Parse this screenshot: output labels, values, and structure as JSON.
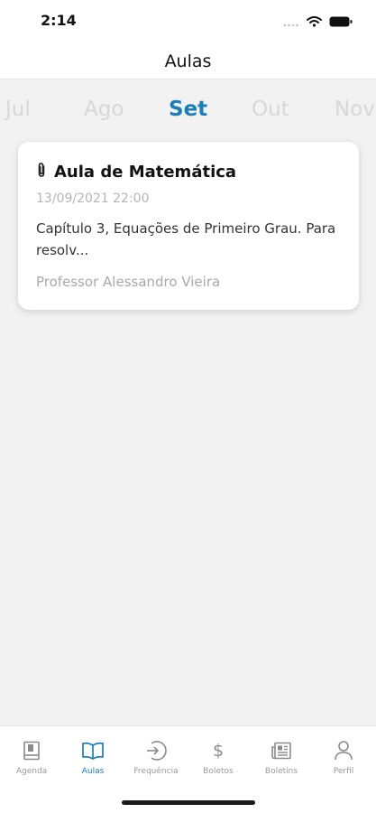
{
  "status_bar": {
    "time": "2:14"
  },
  "header": {
    "title": "Aulas"
  },
  "months": {
    "items": [
      "Jul",
      "Ago",
      "Set",
      "Out",
      "Nov"
    ],
    "selected": "Set"
  },
  "lesson_card": {
    "icon": "paperclip-icon",
    "title": "Aula de Matemática",
    "date": "13/09/2021 22:00",
    "description": "Capítulo 3, Equações de Primeiro Grau. Para resolv...",
    "teacher": "Professor Alessandro Vieira"
  },
  "tabbar": {
    "items": [
      {
        "label": "Agenda",
        "icon": "book-icon"
      },
      {
        "label": "Aulas",
        "icon": "open-book-icon"
      },
      {
        "label": "Frequência",
        "icon": "enter-circle-icon"
      },
      {
        "label": "Boletos",
        "icon": "dollar-icon"
      },
      {
        "label": "Boletins",
        "icon": "newspaper-icon"
      },
      {
        "label": "Perfil",
        "icon": "person-icon"
      }
    ],
    "active": "Aulas"
  },
  "colors": {
    "accent": "#1a7fb8",
    "background": "#f2f2f2",
    "inactive_month": "#d7d7d7",
    "muted_text": "#a9a9a9"
  }
}
